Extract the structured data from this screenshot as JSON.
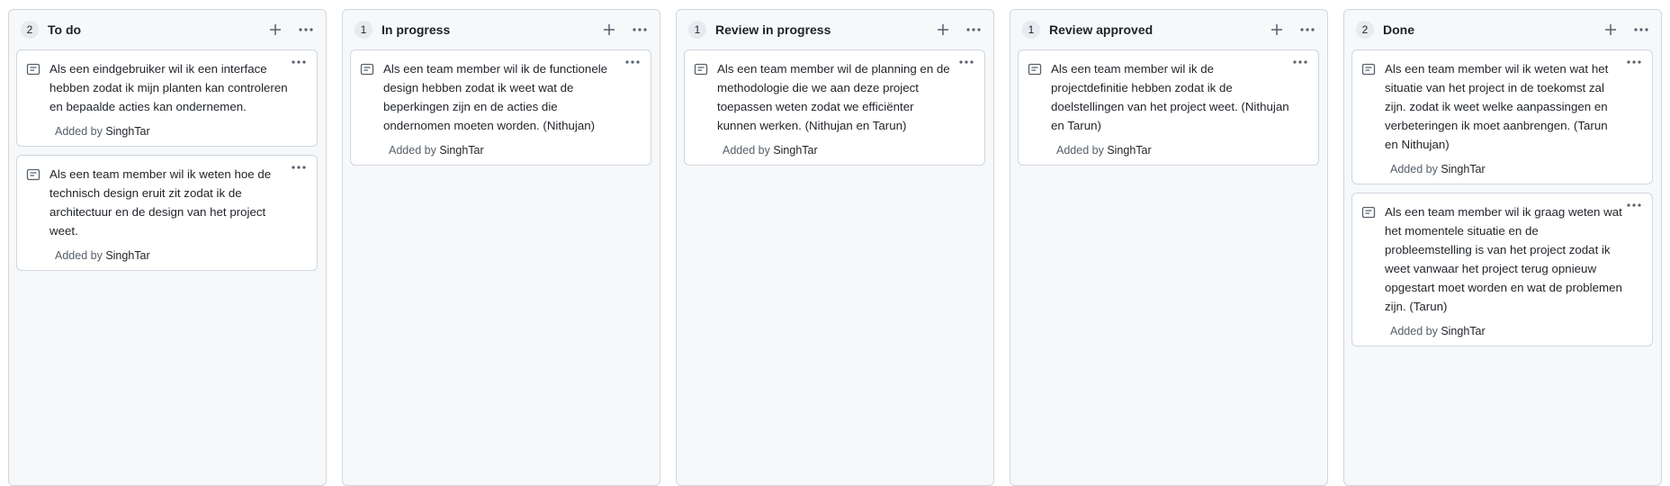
{
  "columns": [
    {
      "title": "To do",
      "count": "2",
      "cards": [
        {
          "text": "Als een eindgebruiker wil ik een interface hebben zodat ik mijn planten kan controleren en bepaalde acties kan ondernemen.",
          "added_label": "Added by",
          "author": "SinghTar"
        },
        {
          "text": "Als een team member wil ik weten hoe de technisch design eruit zit zodat ik de architectuur en de design van het project weet.",
          "added_label": "Added by",
          "author": "SinghTar"
        }
      ]
    },
    {
      "title": "In progress",
      "count": "1",
      "cards": [
        {
          "text": "Als een team member wil ik de functionele design hebben zodat ik weet wat de beperkingen zijn en de acties die ondernomen moeten worden. (Nithujan)",
          "added_label": "Added by",
          "author": "SinghTar"
        }
      ]
    },
    {
      "title": "Review in progress",
      "count": "1",
      "cards": [
        {
          "text": "Als een team member wil de planning en de methodologie die we aan deze project toepassen weten zodat we efficiënter kunnen werken. (Nithujan en Tarun)",
          "added_label": "Added by",
          "author": "SinghTar"
        }
      ]
    },
    {
      "title": "Review approved",
      "count": "1",
      "cards": [
        {
          "text": "Als een team member wil ik de projectdefinitie hebben zodat ik de doelstellingen van het project weet. (Nithujan en Tarun)",
          "added_label": "Added by",
          "author": "SinghTar"
        }
      ]
    },
    {
      "title": "Done",
      "count": "2",
      "cards": [
        {
          "text": "Als een team member wil ik weten wat het situatie van het project in de toekomst zal zijn. zodat ik weet welke aanpassingen en verbeteringen ik moet aanbrengen. (Tarun en Nithujan)",
          "added_label": "Added by",
          "author": "SinghTar"
        },
        {
          "text": "Als een team member wil ik graag weten wat het momentele situatie en de probleemstelling is van het project zodat ik weet vanwaar het project terug opnieuw opgestart moet worden en wat de problemen zijn. (Tarun)",
          "added_label": "Added by",
          "author": "SinghTar"
        }
      ]
    }
  ]
}
